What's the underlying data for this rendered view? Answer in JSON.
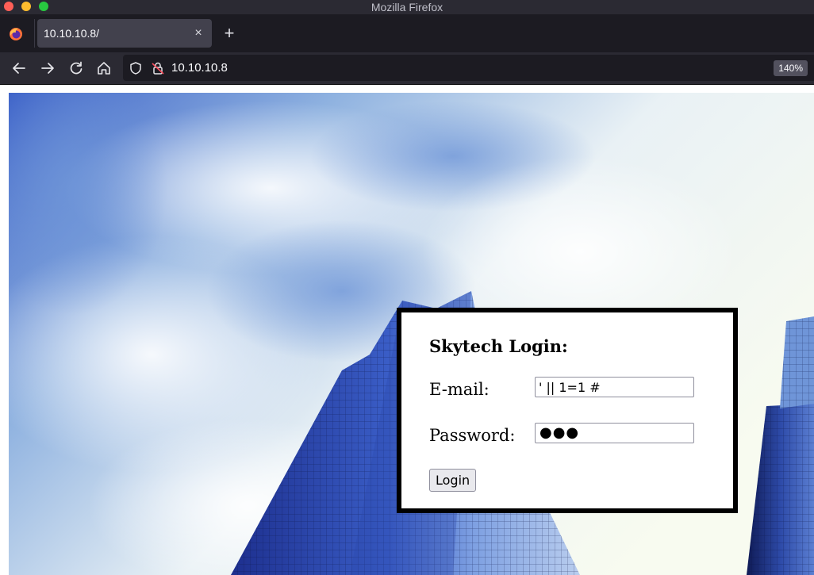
{
  "window": {
    "title": "Mozilla Firefox"
  },
  "tabs": [
    {
      "title": "10.10.10.8/",
      "active": true,
      "close_glyph": "×"
    }
  ],
  "new_tab_glyph": "+",
  "toolbar": {
    "back_icon": "back-arrow-icon",
    "forward_icon": "forward-arrow-icon",
    "reload_icon": "reload-icon",
    "home_icon": "home-icon"
  },
  "urlbar": {
    "url": "10.10.10.8",
    "zoom": "140%",
    "security_icons": [
      "shield-icon",
      "insecure-lock-icon"
    ]
  },
  "page": {
    "background": "sky-and-skyscrapers-photo",
    "login": {
      "title": "Skytech Login:",
      "email_label": "E-mail:",
      "email_value": "' || 1=1 #",
      "password_label": "Password:",
      "password_mask": "●●●",
      "button_label": "Login"
    }
  },
  "colors": {
    "chrome_dark": "#2b2a33",
    "tabstrip": "#1c1b22",
    "active_tab": "#42414d",
    "login_border": "#000000"
  }
}
